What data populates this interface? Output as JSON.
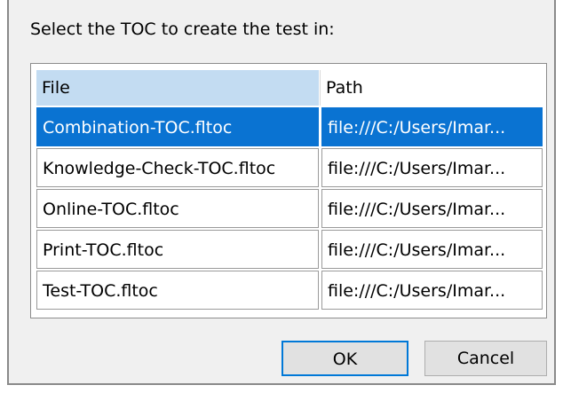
{
  "dialog": {
    "prompt": "Select the TOC to create the test in:"
  },
  "table": {
    "columns": [
      "File",
      "Path"
    ],
    "rows": [
      {
        "file": "Combination-TOC.fltoc",
        "path": "file:///C:/Users/Imar...",
        "selected": true
      },
      {
        "file": "Knowledge-Check-TOC.fltoc",
        "path": "file:///C:/Users/Imar...",
        "selected": false
      },
      {
        "file": "Online-TOC.fltoc",
        "path": "file:///C:/Users/Imar...",
        "selected": false
      },
      {
        "file": "Print-TOC.fltoc",
        "path": "file:///C:/Users/Imar...",
        "selected": false
      },
      {
        "file": "Test-TOC.fltoc",
        "path": "file:///C:/Users/Imar...",
        "selected": false
      }
    ]
  },
  "buttons": {
    "ok": "OK",
    "cancel": "Cancel"
  },
  "colors": {
    "selection": "#0a73d2",
    "header_highlight": "#c3dcf2",
    "dialog_bg": "#f0f0f0",
    "default_button_border": "#0078d7"
  }
}
